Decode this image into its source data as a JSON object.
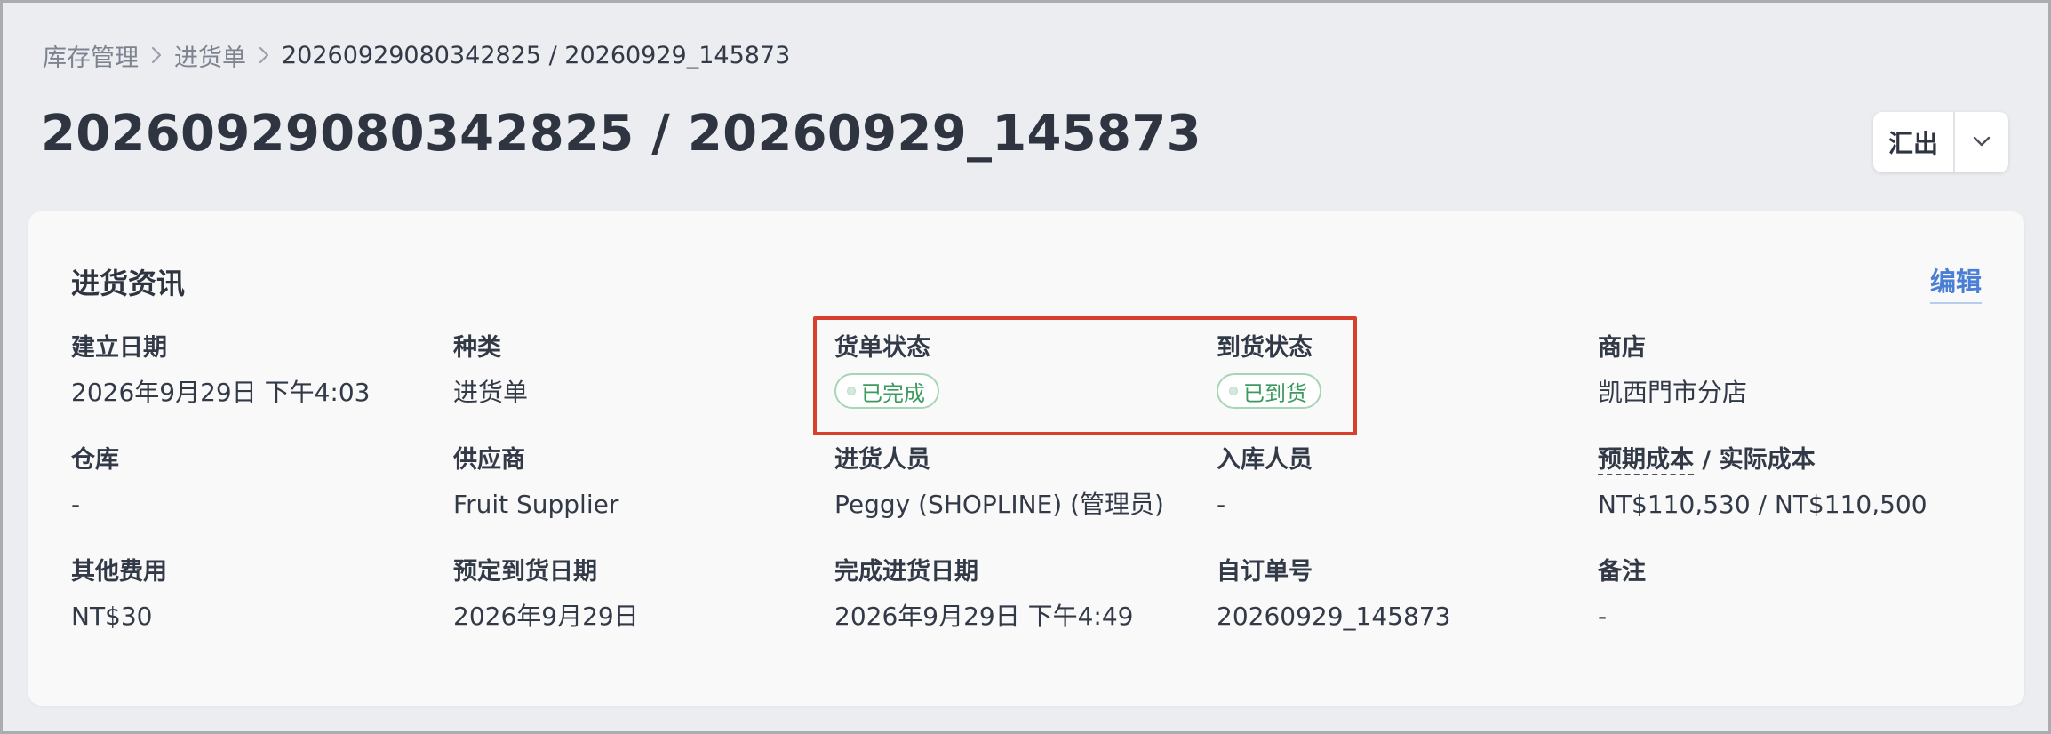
{
  "breadcrumb": {
    "items": [
      "库存管理",
      "进货单"
    ],
    "current": "20260929080342825 / 20260929_145873"
  },
  "page": {
    "title": "20260929080342825 / 20260929_145873"
  },
  "export": {
    "label": "汇出",
    "toggle_icon": "chevron-down-icon"
  },
  "card": {
    "title": "进货资讯",
    "edit_label": "编辑",
    "fields": {
      "created_date": {
        "label": "建立日期",
        "value": "2026年9月29日 下午4:03"
      },
      "type": {
        "label": "种类",
        "value": "进货单"
      },
      "order_status": {
        "label": "货单状态",
        "value": "已完成"
      },
      "arrival_status": {
        "label": "到货状态",
        "value": "已到货"
      },
      "store": {
        "label": "商店",
        "value": "凯西門市分店"
      },
      "warehouse": {
        "label": "仓库",
        "value": "-"
      },
      "supplier": {
        "label": "供应商",
        "value": "Fruit Supplier"
      },
      "purchaser": {
        "label": "进货人员",
        "value": "Peggy (SHOPLINE) (管理员)"
      },
      "receiver": {
        "label": "入库人员",
        "value": "-"
      },
      "cost": {
        "label_expected": "预期成本",
        "label_sep": " / ",
        "label_actual": "实际成本",
        "value": "NT$110,530 / NT$110,500"
      },
      "other_fees": {
        "label": "其他费用",
        "value": "NT$30"
      },
      "expected_arrival": {
        "label": "预定到货日期",
        "value": "2026年9月29日"
      },
      "completed_date": {
        "label": "完成进货日期",
        "value": "2026年9月29日 下午4:49"
      },
      "custom_number": {
        "label": "自订单号",
        "value": "20260929_145873"
      },
      "notes": {
        "label": "备注",
        "value": "-"
      }
    }
  },
  "colors": {
    "background": "#ebedf0",
    "card": "#f9f9fa",
    "link": "#4b7fd6",
    "badge_green": "#3b9a5d",
    "highlight": "#d6402c"
  }
}
